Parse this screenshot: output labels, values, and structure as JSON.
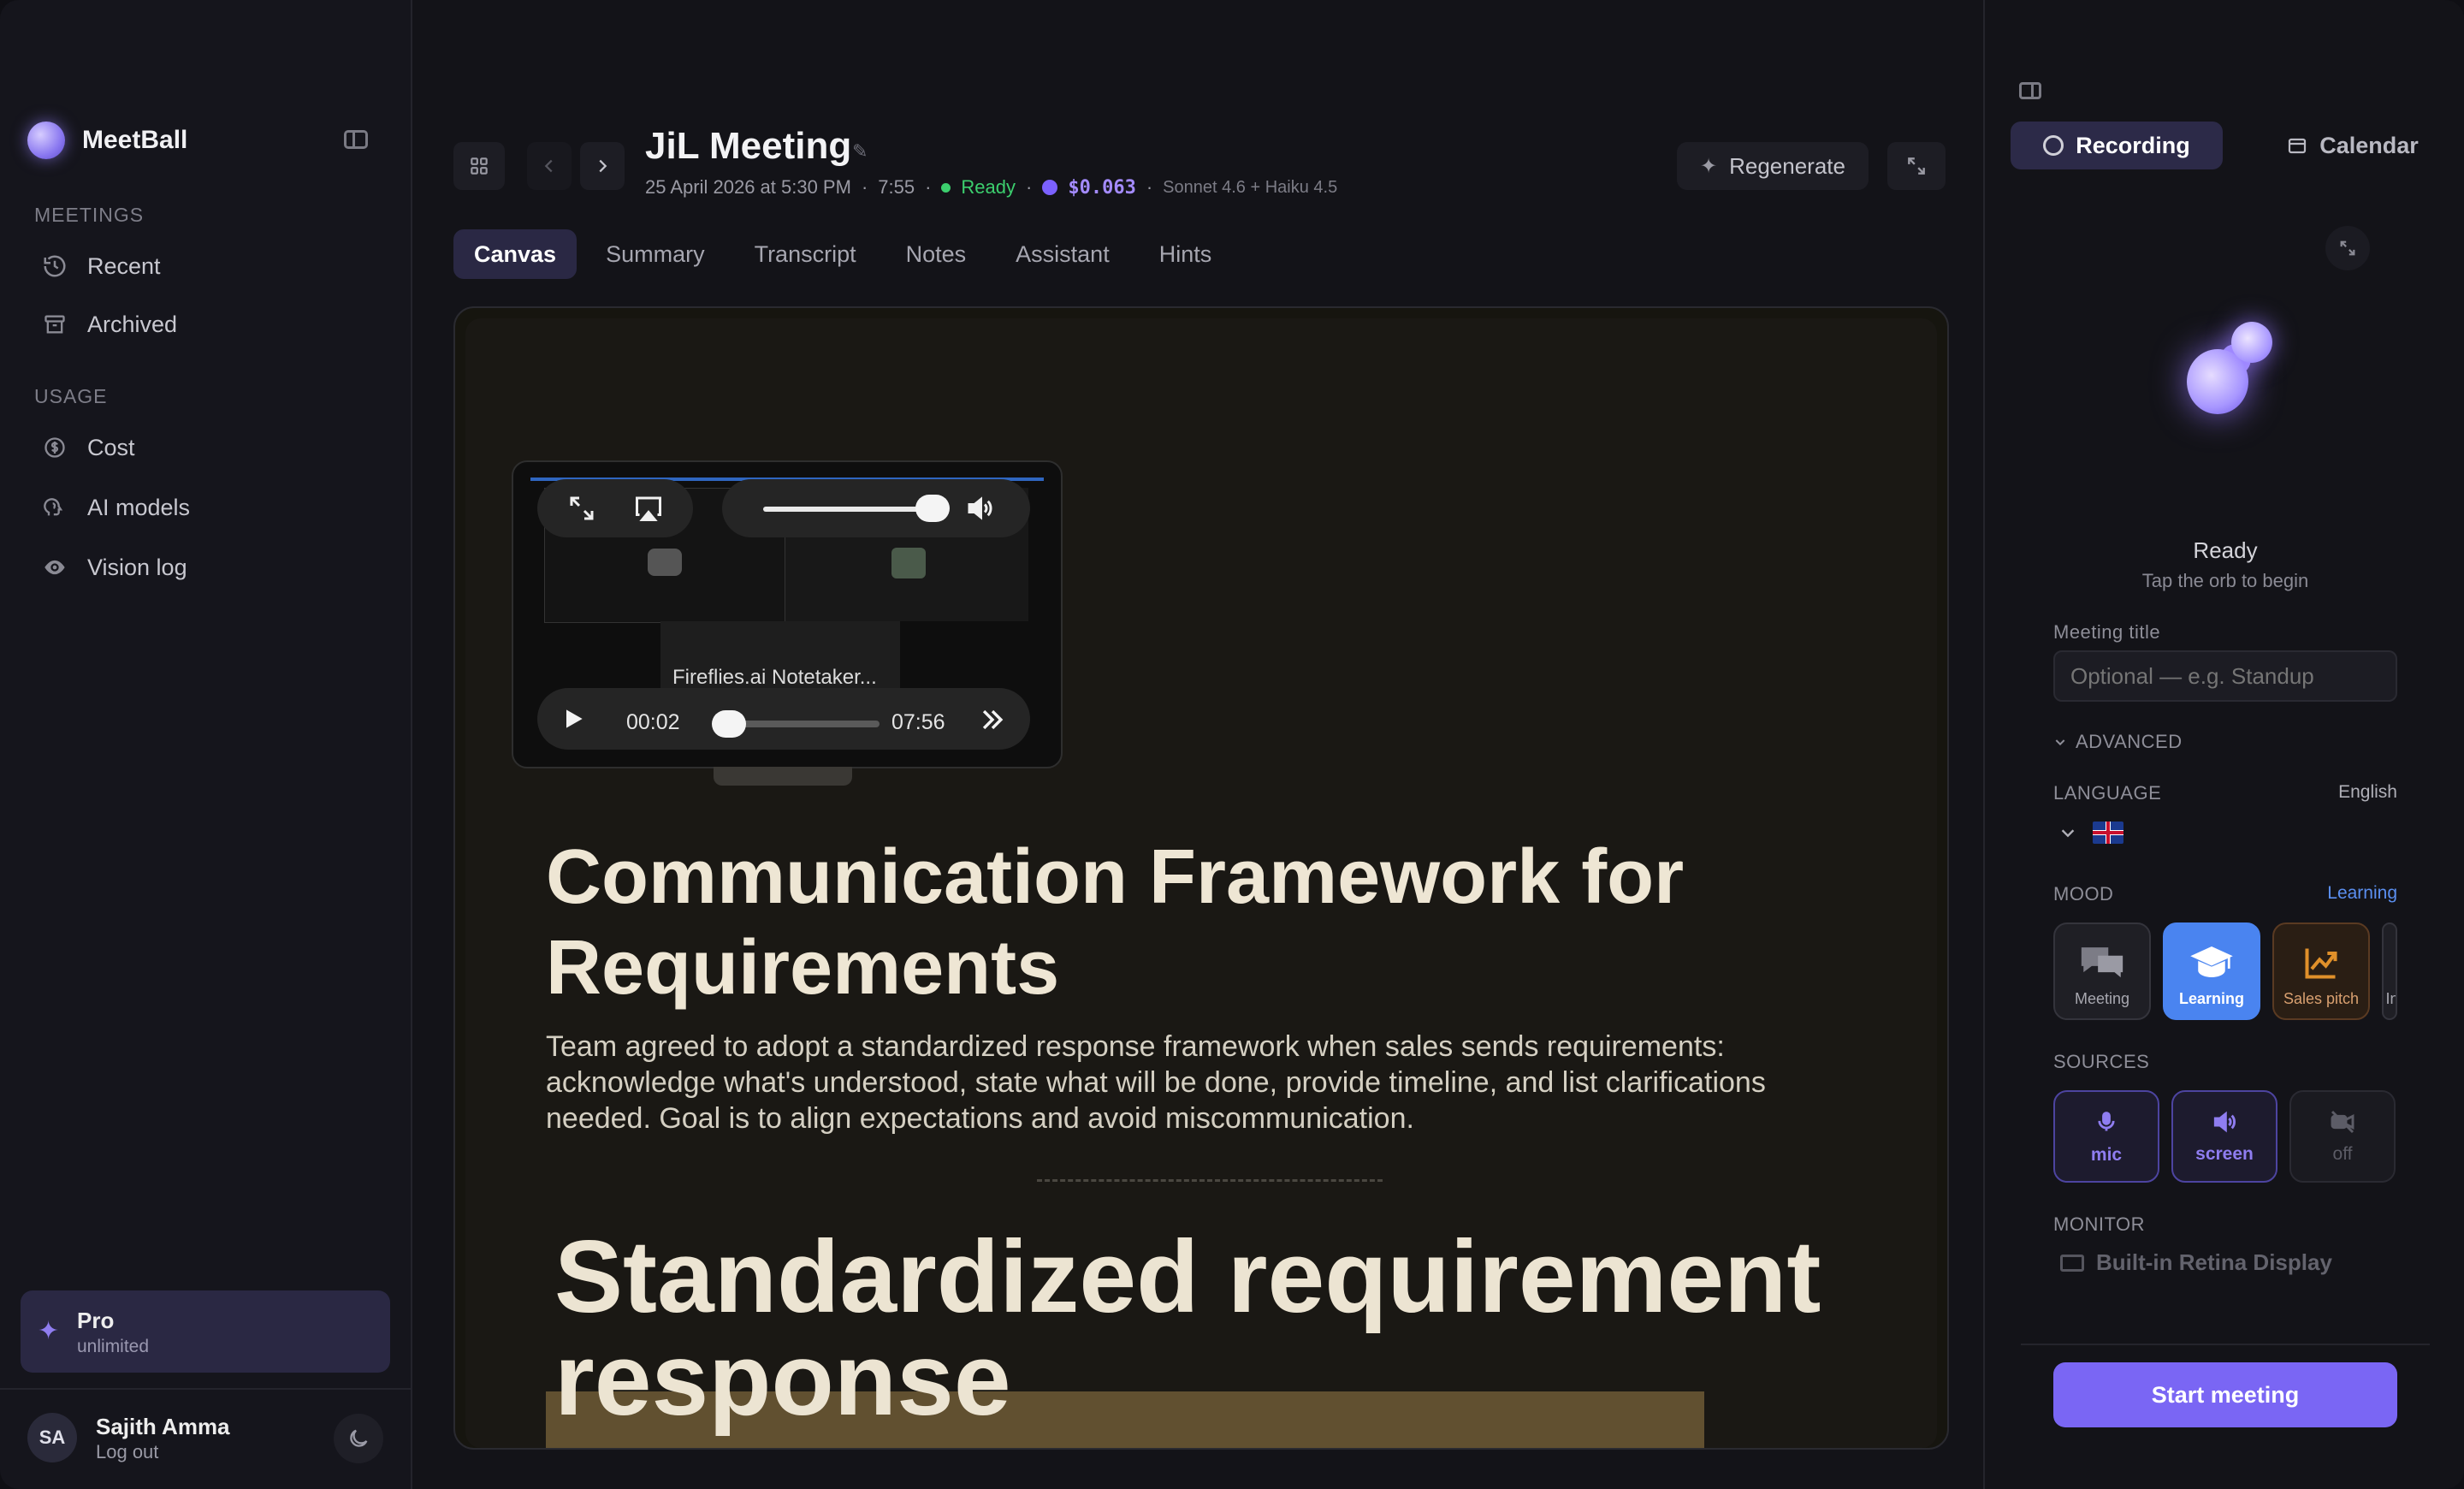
{
  "sidebar": {
    "brand": "MeetBall",
    "sections": [
      {
        "label": "MEETINGS",
        "items": [
          {
            "label": "Recent",
            "icon": "history-icon"
          },
          {
            "label": "Archived",
            "icon": "archive-icon"
          }
        ]
      },
      {
        "label": "USAGE",
        "items": [
          {
            "label": "Cost",
            "icon": "dollar-icon"
          },
          {
            "label": "AI models",
            "icon": "head-icon"
          },
          {
            "label": "Vision log",
            "icon": "eye-icon"
          }
        ]
      }
    ],
    "plan": {
      "title": "Pro",
      "subtitle": "unlimited"
    },
    "user": {
      "initials": "SA",
      "name": "Sajith Amma",
      "action": "Log out"
    }
  },
  "meeting": {
    "title": "JiL Meeting",
    "date": "25 April 2026 at 5:30 PM",
    "duration": "7:55",
    "status": "Ready",
    "cost": "$0.063",
    "models": "Sonnet 4.6 + Haiku 4.5",
    "regenerate_label": "Regenerate"
  },
  "tabs": [
    "Canvas",
    "Summary",
    "Transcript",
    "Notes",
    "Assistant",
    "Hints"
  ],
  "active_tab": "Canvas",
  "player": {
    "participant_label": "Fireflies.ai Notetaker...",
    "current_time": "00:02",
    "total_time": "07:56",
    "progress": 0.004,
    "volume": 0.95
  },
  "canvas": {
    "heading": "Communication Framework for Requirements",
    "paragraph": "Team agreed to adopt a standardized response framework when sales sends requirements: acknowledge what's understood, state what will be done, provide timeline, and list clarifications needed. Goal is to align expectations and avoid miscommunication.",
    "subheading": "Standardized requirement response"
  },
  "panel": {
    "tabs": {
      "recording": "Recording",
      "calendar": "Calendar"
    },
    "status": "Ready",
    "hint": "Tap the orb to begin",
    "meeting_title_label": "Meeting title",
    "meeting_title_placeholder": "Optional — e.g. Standup",
    "advanced_label": "ADVANCED",
    "language_label": "LANGUAGE",
    "language_value": "English",
    "mood_label": "MOOD",
    "mood_value": "Learning",
    "moods": [
      "Meeting",
      "Learning",
      "Sales pitch",
      "In"
    ],
    "sources_label": "SOURCES",
    "sources": [
      "mic",
      "screen",
      "off"
    ],
    "monitor_label": "MONITOR",
    "monitor_value": "Built-in Retina Display",
    "start_label": "Start meeting"
  },
  "colors": {
    "accent": "#7a66f4",
    "ready": "#3ccf6e",
    "learning": "#4a84f0"
  }
}
